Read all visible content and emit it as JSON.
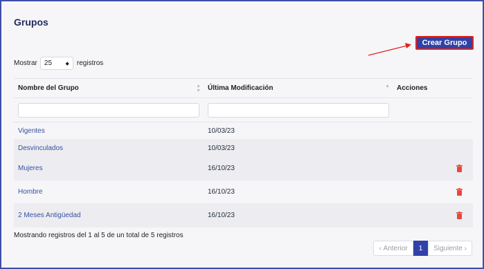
{
  "page": {
    "title": "Grupos"
  },
  "toolbar": {
    "create_label": "Crear Grupo"
  },
  "length_menu": {
    "prefix": "Mostrar",
    "value": "25",
    "suffix": "registros"
  },
  "table": {
    "headers": {
      "name": "Nombre del Grupo",
      "modified": "Última Modificación",
      "actions": "Acciones"
    },
    "rows": [
      {
        "name": "Vigentes",
        "modified": "10/03/23",
        "deletable": false
      },
      {
        "name": "Desvinculados",
        "modified": "10/03/23",
        "deletable": false
      },
      {
        "name": "Mujeres",
        "modified": "16/10/23",
        "deletable": true
      },
      {
        "name": "Hombre",
        "modified": "16/10/23",
        "deletable": true
      },
      {
        "name": "2 Meses Antigüedad",
        "modified": "16/10/23",
        "deletable": true
      }
    ]
  },
  "info": "Mostrando registros del 1 al 5 de un total de 5 registros",
  "pagination": {
    "prev": "Anterior",
    "current": "1",
    "next": "Siguiente"
  },
  "colors": {
    "primary": "#3042a8",
    "delete": "#e5483b",
    "link": "#3450a0",
    "highlight": "#e0241b"
  },
  "icons": {
    "delete": "trash-icon",
    "prev": "chevron-left-icon",
    "next": "chevron-right-icon"
  }
}
